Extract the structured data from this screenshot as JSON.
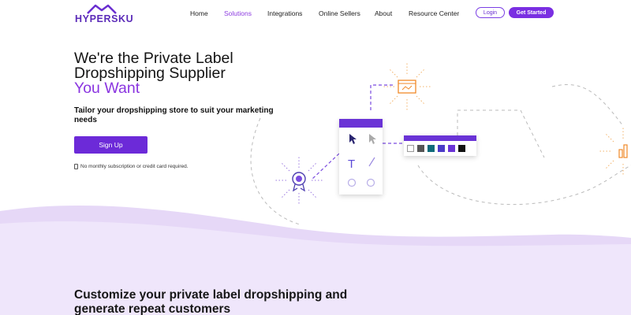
{
  "nav": {
    "logo_text": "HYPERSKU",
    "links": [
      "Home",
      "Solutions",
      "Integrations",
      "Online Sellers",
      "About",
      "Resource Center"
    ],
    "active_link": "Solutions",
    "login_label": "Login",
    "get_started_label": "Get Started"
  },
  "hero": {
    "title_line1": "We're the Private Label",
    "title_line2": "Dropshipping Supplier",
    "title_line3": "You Want",
    "subtitle": "Tailor your dropshipping store to suit your marketing needs",
    "signup_label": "Sign Up",
    "note": "No monthly subscription or credit card required."
  },
  "section": {
    "title": "Customize your private label dropshipping and generate repeat customers"
  },
  "colors": {
    "brand": "#6c2ad8",
    "accent": "#8a35e0",
    "wave": "#e9ddf8",
    "palette": [
      "#ffffff",
      "#555555",
      "#0f6a7a",
      "#4b3bc8",
      "#6a33d6",
      "#111111"
    ]
  },
  "icons": [
    "logo-roof-icon",
    "card-icon",
    "browser-window-icon",
    "award-badge-icon",
    "chart-icon",
    "cursor-icon",
    "text-tool-icon",
    "line-tool-icon",
    "circle-tool-icon"
  ]
}
